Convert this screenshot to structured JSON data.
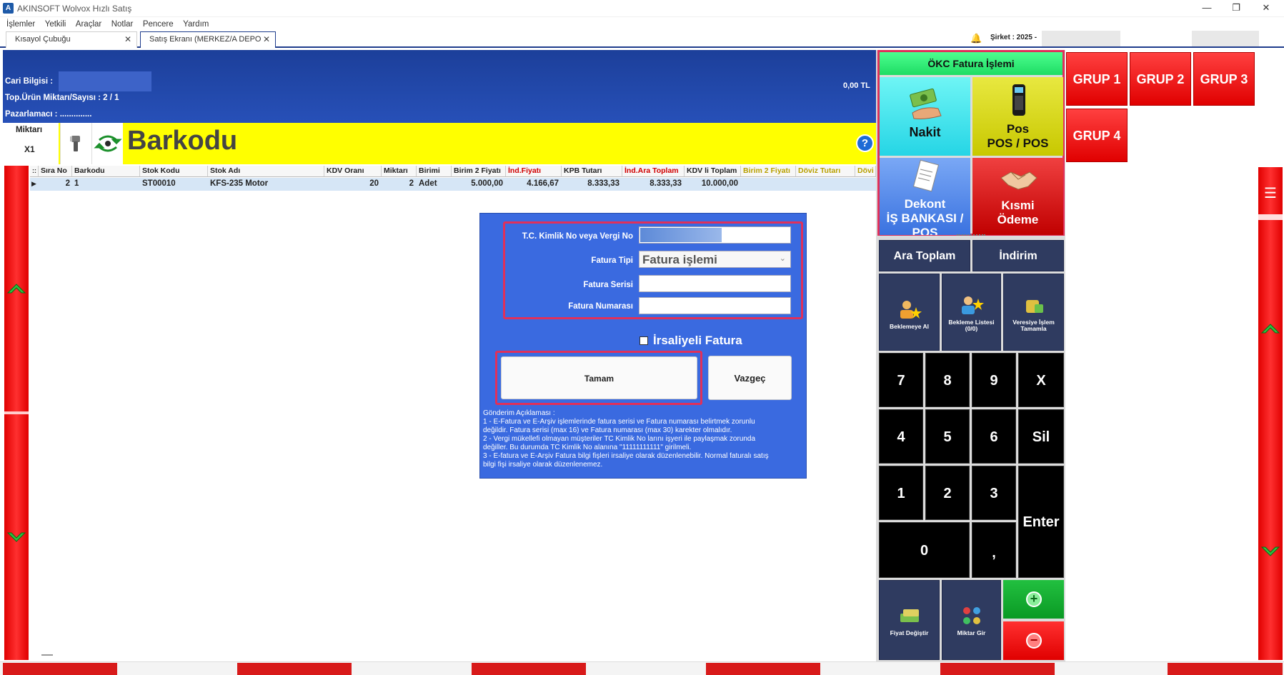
{
  "window": {
    "title": "AKINSOFT Wolvox Hızlı Satış",
    "app_icon": "A",
    "minimize": "—",
    "maximize": "❐",
    "close": "✕"
  },
  "menu": [
    "İşlemler",
    "Yetkili",
    "Araçlar",
    "Notlar",
    "Pencere",
    "Yardım"
  ],
  "tabs": [
    {
      "label": "Kısayol Çubuğu",
      "close": "✕"
    },
    {
      "label": "Satış Ekranı (MERKEZ/A DEPO",
      "close": "✕"
    }
  ],
  "header": {
    "sirket_label": "Şirket : 2025 -"
  },
  "info": {
    "cari_bilgisi": "Cari Bilgisi :",
    "top_urun": "Top.Ürün Miktarı/Sayısı : 2 / 1",
    "pazarlamaci": "Pazarlamacı : ..............",
    "total": "0,00 TL"
  },
  "barcode": {
    "miktar_label": "Miktarı",
    "miktar_value": "X1",
    "title": "Barkodu",
    "help": "?"
  },
  "grid": {
    "headers": [
      "Sıra No",
      "Barkodu",
      "Stok Kodu",
      "Stok Adı",
      "KDV Oranı",
      "Miktarı",
      "Birimi",
      "Birim 2 Fiyatı",
      "İnd.Fiyatı",
      "KPB Tutarı",
      "İnd.Ara Toplam",
      "KDV li Toplam",
      "Birim 2 Fiyatı",
      "Döviz Tutarı",
      "Dövi"
    ],
    "row": {
      "sira": "2",
      "barkod": "1",
      "stok_kodu": "ST00010",
      "stok_adi": "KFS-235 Motor",
      "kdv": "20",
      "miktar": "2",
      "birim": "Adet",
      "birim2": "5.000,00",
      "ind_fiyat": "4.166,67",
      "kpb": "8.333,33",
      "ind_ara": "8.333,33",
      "kdv_toplam": "10.000,00"
    }
  },
  "dialog": {
    "tc_label": "T.C. Kimlik No veya Vergi No",
    "fatura_tipi_label": "Fatura Tipi",
    "fatura_tipi_value": "Fatura işlemi",
    "fatura_serisi_label": "Fatura Serisi",
    "fatura_numarasi_label": "Fatura Numarası",
    "irsaliyeli": "İrsaliyeli Fatura",
    "tamam": "Tamam",
    "vazgec": "Vazgeç",
    "note_title": "Gönderim Açıklaması :",
    "note_lines": [
      "1 - E-Fatura ve E-Arşiv  işlemlerinde fatura serisi ve Fatura numarası belirtmek zorunlu",
      "değildir. Fatura serisi (max 16) ve Fatura numarası (max 30) karekter olmalıdır.",
      "2 - Vergi mükellefi olmayan müşteriler TC Kimlik No larını işyeri ile paylaşmak zorunda",
      "değiller. Bu durumda TC Kimlik No alanına \"11111111111\" girilmeli.",
      "3 - E-fatura ve E-Arşiv Fatura bilgi fişleri irsaliye olarak düzenlenebilir. Normal faturalı satış",
      "bilgi fişi irsaliye olarak düzenlenemez."
    ]
  },
  "payment": {
    "okc": "ÖKC Fatura İşlemi",
    "nakit": "Nakit",
    "pos_line1": "Pos",
    "pos_line2": "POS / POS",
    "dekont_line1": "Dekont",
    "dekont_line2": "İŞ BANKASI /",
    "dekont_line3": "POS",
    "kismi_line1": "Kısmi",
    "kismi_line2": "Ödeme",
    "grup": [
      "GRUP 1",
      "GRUP 2",
      "GRUP 3",
      "GRUP 4"
    ],
    "ara_toplam": "Ara Toplam",
    "indirim": "İndirim",
    "beklemeye_al": "Beklemeye Al",
    "bekleme_listesi": "Bekleme Listesi (0/0)",
    "veresiye": "Veresiye İşlem Tamamla",
    "keys": [
      "7",
      "8",
      "9",
      "X",
      "4",
      "5",
      "6",
      "Sil",
      "1",
      "2",
      "3",
      "0",
      ",",
      "Enter"
    ],
    "fiyat_degistir": "Fiyat Değiştir",
    "miktar_gir": "Miktar Gir",
    "plus": "+",
    "minus": "−"
  },
  "colors": {
    "navy": "#1e3c8c",
    "yellow": "#ffff00",
    "red": "#e00000",
    "green": "#00a020",
    "dialog_blue": "#3a6ae0"
  }
}
